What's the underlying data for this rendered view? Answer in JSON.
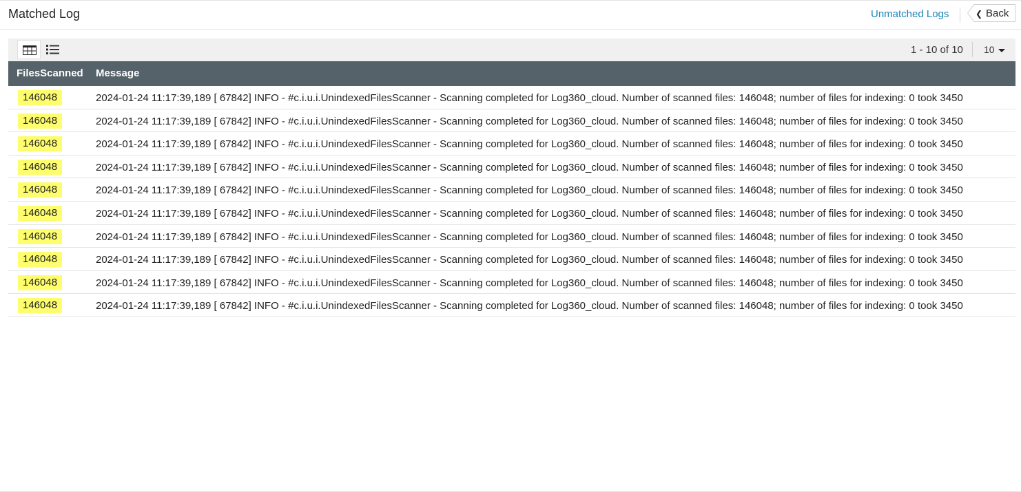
{
  "header": {
    "title": "Matched Log",
    "unmatched_link": "Unmatched Logs",
    "back_label": "Back"
  },
  "toolbar": {
    "views": [
      "table-view-icon",
      "list-view-icon"
    ],
    "pager_text": "1 - 10 of 10",
    "page_size": "10"
  },
  "table": {
    "columns": [
      "FilesScanned",
      "Message"
    ],
    "rows": [
      {
        "files": "146048",
        "message": "2024-01-24 11:17:39,189 [ 67842] INFO - #c.i.u.i.UnindexedFilesScanner - Scanning completed for Log360_cloud. Number of scanned files: 146048; number of files for indexing: 0 took 3450"
      },
      {
        "files": "146048",
        "message": "2024-01-24 11:17:39,189 [ 67842] INFO - #c.i.u.i.UnindexedFilesScanner - Scanning completed for Log360_cloud. Number of scanned files: 146048; number of files for indexing: 0 took 3450"
      },
      {
        "files": "146048",
        "message": "2024-01-24 11:17:39,189 [ 67842] INFO - #c.i.u.i.UnindexedFilesScanner - Scanning completed for Log360_cloud. Number of scanned files: 146048; number of files for indexing: 0 took 3450"
      },
      {
        "files": "146048",
        "message": "2024-01-24 11:17:39,189 [ 67842] INFO - #c.i.u.i.UnindexedFilesScanner - Scanning completed for Log360_cloud. Number of scanned files: 146048; number of files for indexing: 0 took 3450"
      },
      {
        "files": "146048",
        "message": "2024-01-24 11:17:39,189 [ 67842] INFO - #c.i.u.i.UnindexedFilesScanner - Scanning completed for Log360_cloud. Number of scanned files: 146048; number of files for indexing: 0 took 3450"
      },
      {
        "files": "146048",
        "message": "2024-01-24 11:17:39,189 [ 67842] INFO - #c.i.u.i.UnindexedFilesScanner - Scanning completed for Log360_cloud. Number of scanned files: 146048; number of files for indexing: 0 took 3450"
      },
      {
        "files": "146048",
        "message": "2024-01-24 11:17:39,189 [ 67842] INFO - #c.i.u.i.UnindexedFilesScanner - Scanning completed for Log360_cloud. Number of scanned files: 146048; number of files for indexing: 0 took 3450"
      },
      {
        "files": "146048",
        "message": "2024-01-24 11:17:39,189 [ 67842] INFO - #c.i.u.i.UnindexedFilesScanner - Scanning completed for Log360_cloud. Number of scanned files: 146048; number of files for indexing: 0 took 3450"
      },
      {
        "files": "146048",
        "message": "2024-01-24 11:17:39,189 [ 67842] INFO - #c.i.u.i.UnindexedFilesScanner - Scanning completed for Log360_cloud. Number of scanned files: 146048; number of files for indexing: 0 took 3450"
      },
      {
        "files": "146048",
        "message": "2024-01-24 11:17:39,189 [ 67842] INFO - #c.i.u.i.UnindexedFilesScanner - Scanning completed for Log360_cloud. Number of scanned files: 146048; number of files for indexing: 0 took 3450"
      }
    ]
  },
  "colors": {
    "header_bg": "#566269",
    "highlight": "#fdfd6e",
    "link": "#1a86b8",
    "toolbar_bg": "#f0f0f0"
  }
}
